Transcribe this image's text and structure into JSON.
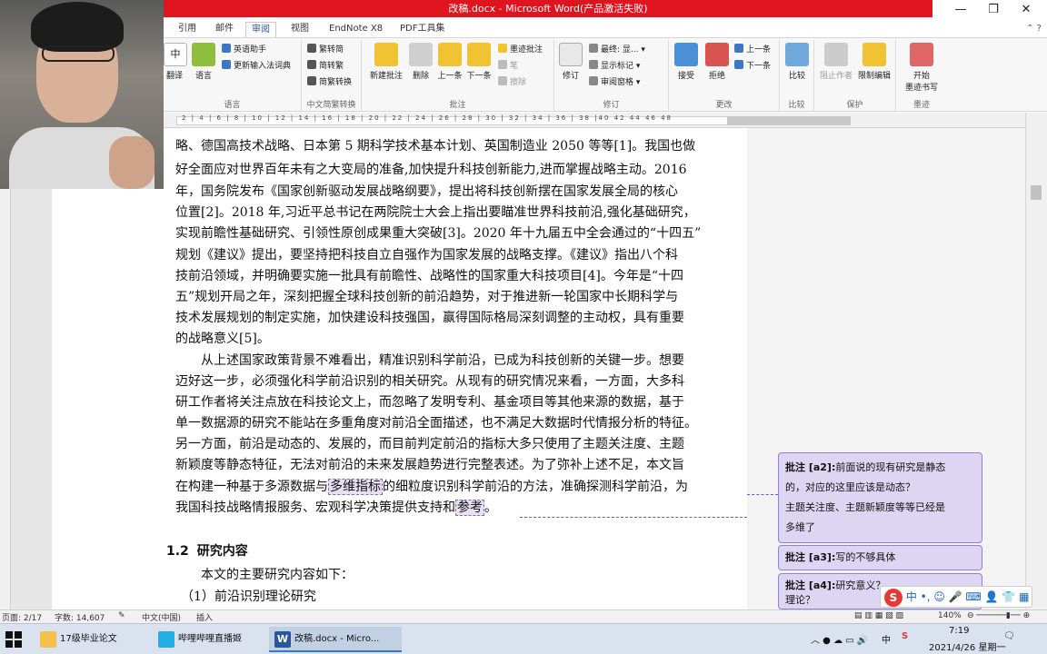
{
  "window": {
    "title": "改稿.docx - Microsoft Word(产品激活失败)",
    "controls": [
      "—",
      "❐",
      "✕"
    ]
  },
  "tabs": [
    {
      "label": "引用"
    },
    {
      "label": "邮件"
    },
    {
      "label": "审阅",
      "active": true
    },
    {
      "label": "视图"
    },
    {
      "label": "EndNote X8"
    },
    {
      "label": "PDF工具集"
    }
  ],
  "ribbon": {
    "groups": {
      "language": {
        "label": "语言",
        "translate": "翻译",
        "language": "语言",
        "english_assistant": "英语助手",
        "update_ime": "更新输入法词典"
      },
      "chinese_convert": {
        "label": "中文简繁转换",
        "to_simplified": "繁转简",
        "to_traditional": "简转繁",
        "convert": "简繁转换"
      },
      "comments": {
        "label": "批注",
        "new": "新建批注",
        "delete": "删除",
        "prev": "上一条",
        "next": "下一条",
        "ink": "墨迹批注",
        "pen": "笔",
        "eraser": "擦除"
      },
      "tracking": {
        "label": "修订",
        "track": "修订",
        "final": "最终: 显...",
        "show_markup": "显示标记",
        "review_pane": "审阅窗格"
      },
      "changes": {
        "label": "更改",
        "accept": "接受",
        "reject": "拒绝",
        "prev": "上一条",
        "next": "下一条"
      },
      "compare": {
        "label": "比较",
        "compare": "比较"
      },
      "protect": {
        "label": "保护",
        "block_authors": "阻止作者",
        "restrict": "限制编辑"
      },
      "ink": {
        "label": "墨迹",
        "start_ink": "开始",
        "start_ink2": "墨迹书写"
      }
    }
  },
  "ruler": {
    "numbers": "2  | 4  | 6  | 8  | 10 | 12 | 14 | 16 | 18 | 20 | 22 | 24 | 26 | 28 | 30 | 32 | 34 | 36 | 38 |40  42  44  46  48"
  },
  "document": {
    "lines": [
      {
        "text": "略、德国高技术战略、日本第 5 期科学技术基本计划、英国制造业 2050 等等[1]。我国也做"
      },
      {
        "text": "好全面应对世界百年未有之大变局的准备,加快提升科技创新能力,进而掌握战略主动。2016"
      },
      {
        "text": "年，国务院发布《国家创新驱动发展战略纲要》，提出将科技创新摆在国家发展全局的核心"
      },
      {
        "text": "位置[2]。2018 年,习近平总书记在两院院士大会上指出要瞄准世界科技前沿,强化基础研究，"
      },
      {
        "text": "实现前瞻性基础研究、引领性原创成果重大突破[3]。2020 年十九届五中全会通过的“十四五”"
      },
      {
        "text": "规划《建议》提出，要坚持把科技自立自强作为国家发展的战略支撑。《建议》指出八个科"
      },
      {
        "text": "技前沿领域，并明确要实施一批具有前瞻性、战略性的国家重大科技项目[4]。今年是“十四"
      },
      {
        "text": "五”规划开局之年，深刻把握全球科技创新的前沿趋势，对于推进新一轮国家中长期科学与"
      },
      {
        "text": "技术发展规划的制定实施，加快建设科技强国，赢得国际格局深刻调整的主动权，具有重要"
      },
      {
        "text": "的战略意义[5]。"
      },
      {
        "text": "　　从上述国家政策背景不难看出，精准识别科学前沿，已成为科技创新的关键一步。想要"
      },
      {
        "text": "迈好这一步，必须强化科学前沿识别的相关研究。从现有的研究情况来看，一方面，大多科"
      },
      {
        "text": "研工作者将关注点放在科技论文上，而忽略了发明专利、基金项目等其他来源的数据，基于"
      },
      {
        "text": "单一数据源的研究不能站在多重角度对前沿全面描述，也不满足大数据时代情报分析的特征。"
      },
      {
        "text": "另一方面，前沿是动态的、发展的，而目前判定前沿的指标大多只使用了主题关注度、主题"
      },
      {
        "text": "新颖度等静态特征，无法对前沿的未来发展趋势进行完整表述。为了弥补上述不足，本文旨"
      }
    ],
    "line17": {
      "a": "在构建一种基于多源数据与",
      "b": "多维指标",
      "c": "的细粒度识别科学前沿的方法，准确探测科学前沿，为"
    },
    "line18": {
      "a": "我国科技战略情报服务、宏观科学决策提供支持和",
      "b": "参考",
      "c": "。"
    },
    "heading_num": "1.2",
    "heading": "研究内容",
    "body1": "　　本文的主要研究内容如下：",
    "body2": "（1）前沿识别理论研究"
  },
  "comments": [
    {
      "tag": "批注 [a2]:",
      "text1": "前面说的现有研究是静态",
      "text2": "的，对应的这里应该是动态？",
      "text3": "主题关注度、主题新颖度等等已经是",
      "text4": "多维了"
    },
    {
      "tag": "批注 [a3]:",
      "text1": "写的不够具体"
    },
    {
      "tag": "批注 [a4]:",
      "text1": "研究意义？",
      "text2": "理论？"
    }
  ],
  "statusbar": {
    "page": "页面: 2/17",
    "words": "字数: 14,607",
    "lang": "中文(中国)",
    "mode": "插入",
    "zoom": "140%"
  },
  "taskbar": {
    "items": [
      {
        "label": "17级毕业论文"
      },
      {
        "label": "哔哩哔哩直播姬"
      },
      {
        "label": "改稿.docx - Micro..."
      }
    ],
    "ime": "中",
    "time": "7:19",
    "date": "2021/4/26 星期一"
  },
  "colors": {
    "title_red": "#e0141e",
    "comment_bg": "#ddd6f2",
    "comment_border": "#8f80d0"
  }
}
